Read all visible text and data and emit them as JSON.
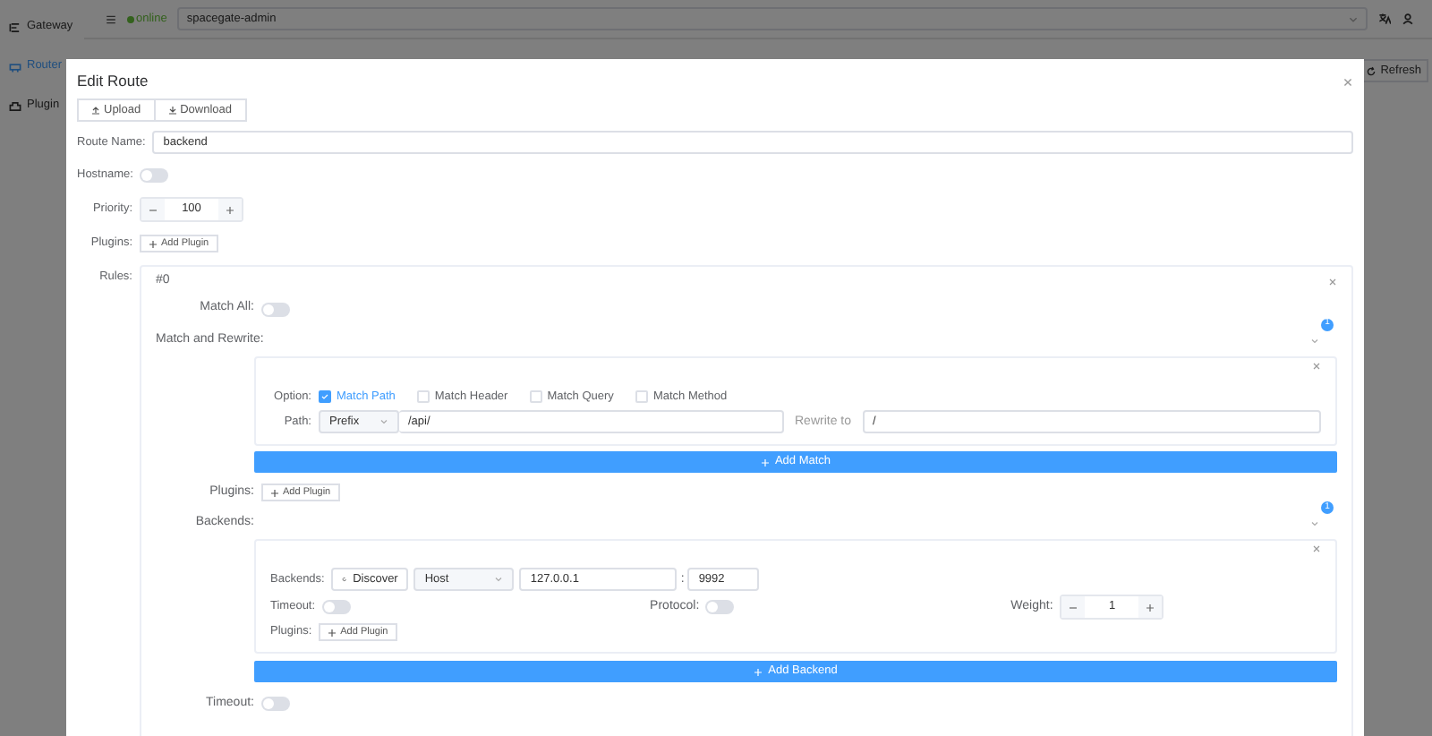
{
  "sidebar": {
    "items": [
      {
        "label": "Gateway",
        "selected": false
      },
      {
        "label": "Router",
        "selected": true
      },
      {
        "label": "Plugin",
        "selected": false
      }
    ]
  },
  "header": {
    "status": "online",
    "gateway_select": {
      "value": "spacegate-admin"
    }
  },
  "toolbar": {
    "refresh": "Refresh"
  },
  "dialog": {
    "title": "Edit Route",
    "buttons": [
      "Upload",
      "Download"
    ],
    "route_name": {
      "label": "Route Name:",
      "value": "backend"
    },
    "hostname": {
      "label": "Hostname:",
      "on": false
    },
    "priority": {
      "label": "Priority:",
      "value": "100"
    },
    "plugins": {
      "label": "Plugins:",
      "button": "Add Plugin"
    },
    "rules": {
      "label": "Rules:",
      "items": [
        {
          "title": "#0",
          "match_all": {
            "label": "Match All:",
            "on": false
          },
          "match_and_rewrite": {
            "label": "Match and Rewrite:",
            "badge": "1",
            "matches": [
              {
                "option_label": "Option:",
                "options": [
                  {
                    "label": "Match Path",
                    "checked": true
                  },
                  {
                    "label": "Match Header",
                    "checked": false
                  },
                  {
                    "label": "Match Query",
                    "checked": false
                  },
                  {
                    "label": "Match Method",
                    "checked": false
                  }
                ],
                "path_label": "Path:",
                "path_type": "Prefix",
                "path_value": "/api/",
                "rewrite_label": "Rewrite to",
                "rewrite_value": "/"
              }
            ],
            "add_button": "Add Match"
          },
          "plugins": {
            "label": "Plugins:",
            "button": "Add Plugin"
          },
          "backends": {
            "label": "Backends:",
            "badge": "1",
            "items": [
              {
                "label": "Backends:",
                "discover": "Discover",
                "kind_select": "Host",
                "host": "127.0.0.1",
                "separator": ":",
                "port": "9992",
                "timeout": {
                  "label": "Timeout:",
                  "on": false
                },
                "protocol": {
                  "label": "Protocol:",
                  "on": false
                },
                "weight": {
                  "label": "Weight:",
                  "value": "1"
                },
                "plugins": {
                  "label": "Plugins:",
                  "button": "Add Plugin"
                }
              }
            ],
            "add_button": "Add Backend"
          },
          "timeout": {
            "label": "Timeout:",
            "on": false
          }
        }
      ]
    }
  }
}
